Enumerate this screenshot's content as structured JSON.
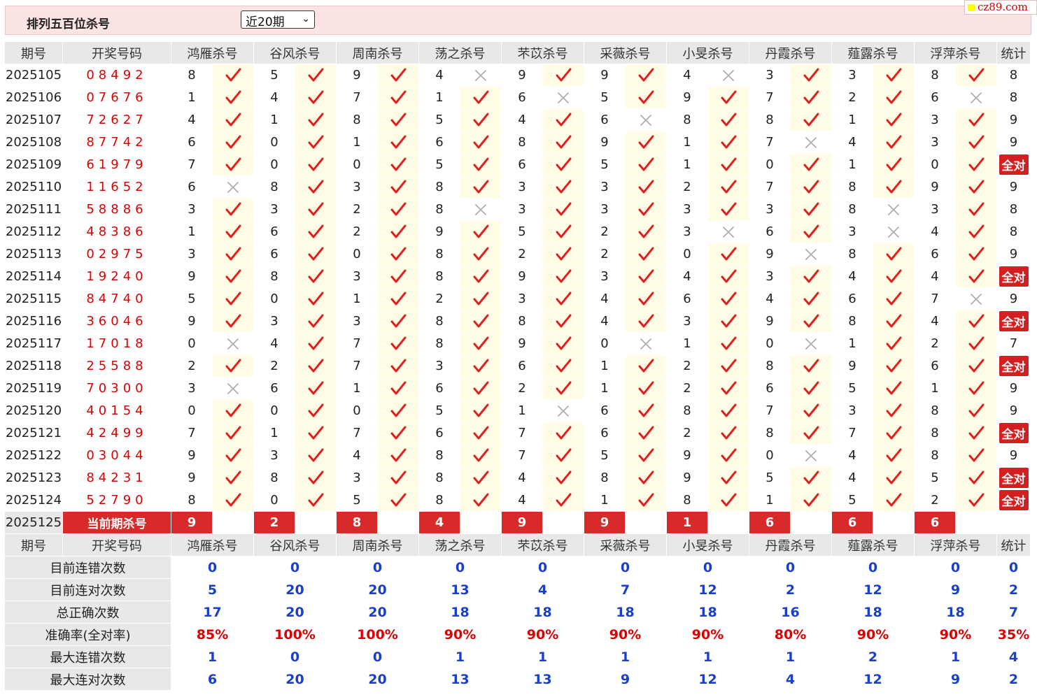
{
  "header": {
    "title": "排列五百位杀号",
    "period_select": "近20期",
    "logo": "cz89.com"
  },
  "columns": {
    "period": "期号",
    "draw": "开奖号码",
    "experts": [
      "鸿雁杀号",
      "谷风杀号",
      "周南杀号",
      "荡之杀号",
      "芣苡杀号",
      "采薇杀号",
      "小旻杀号",
      "丹霞杀号",
      "薤露杀号",
      "浮萍杀号"
    ],
    "stat": "统计"
  },
  "rows": [
    {
      "period": "2025105",
      "draw": "08492",
      "kills": [
        "8",
        "5",
        "9",
        "4",
        "9",
        "9",
        "4",
        "3",
        "3",
        "8"
      ],
      "marks": [
        1,
        1,
        1,
        0,
        1,
        1,
        0,
        1,
        1,
        1
      ],
      "stat": "8"
    },
    {
      "period": "2025106",
      "draw": "07676",
      "kills": [
        "1",
        "4",
        "7",
        "1",
        "6",
        "5",
        "9",
        "7",
        "2",
        "6"
      ],
      "marks": [
        1,
        1,
        1,
        1,
        0,
        1,
        1,
        1,
        1,
        0
      ],
      "stat": "8"
    },
    {
      "period": "2025107",
      "draw": "72627",
      "kills": [
        "4",
        "1",
        "8",
        "5",
        "4",
        "6",
        "8",
        "8",
        "1",
        "3"
      ],
      "marks": [
        1,
        1,
        1,
        1,
        1,
        0,
        1,
        1,
        1,
        1
      ],
      "stat": "9"
    },
    {
      "period": "2025108",
      "draw": "87742",
      "kills": [
        "6",
        "0",
        "1",
        "6",
        "8",
        "9",
        "1",
        "7",
        "4",
        "3"
      ],
      "marks": [
        1,
        1,
        1,
        1,
        1,
        1,
        1,
        0,
        1,
        1
      ],
      "stat": "9"
    },
    {
      "period": "2025109",
      "draw": "61979",
      "kills": [
        "7",
        "0",
        "0",
        "5",
        "6",
        "5",
        "1",
        "0",
        "1",
        "0"
      ],
      "marks": [
        1,
        1,
        1,
        1,
        1,
        1,
        1,
        1,
        1,
        1
      ],
      "stat": "全对"
    },
    {
      "period": "2025110",
      "draw": "11652",
      "kills": [
        "6",
        "8",
        "3",
        "8",
        "3",
        "3",
        "2",
        "7",
        "8",
        "9"
      ],
      "marks": [
        0,
        1,
        1,
        1,
        1,
        1,
        1,
        1,
        1,
        1
      ],
      "stat": "9"
    },
    {
      "period": "2025111",
      "draw": "58886",
      "kills": [
        "3",
        "3",
        "2",
        "8",
        "3",
        "3",
        "3",
        "3",
        "8",
        "3"
      ],
      "marks": [
        1,
        1,
        1,
        0,
        1,
        1,
        1,
        1,
        0,
        1
      ],
      "stat": "8"
    },
    {
      "period": "2025112",
      "draw": "48386",
      "kills": [
        "1",
        "6",
        "2",
        "9",
        "5",
        "2",
        "3",
        "6",
        "3",
        "4"
      ],
      "marks": [
        1,
        1,
        1,
        1,
        1,
        1,
        0,
        1,
        0,
        1
      ],
      "stat": "8"
    },
    {
      "period": "2025113",
      "draw": "02975",
      "kills": [
        "3",
        "6",
        "0",
        "8",
        "2",
        "2",
        "0",
        "9",
        "8",
        "6"
      ],
      "marks": [
        1,
        1,
        1,
        1,
        1,
        1,
        1,
        0,
        1,
        1
      ],
      "stat": "9"
    },
    {
      "period": "2025114",
      "draw": "19240",
      "kills": [
        "9",
        "8",
        "3",
        "8",
        "9",
        "3",
        "4",
        "3",
        "4",
        "4"
      ],
      "marks": [
        1,
        1,
        1,
        1,
        1,
        1,
        1,
        1,
        1,
        1
      ],
      "stat": "全对"
    },
    {
      "period": "2025115",
      "draw": "84740",
      "kills": [
        "5",
        "0",
        "1",
        "2",
        "3",
        "4",
        "6",
        "4",
        "6",
        "7"
      ],
      "marks": [
        1,
        1,
        1,
        1,
        1,
        1,
        1,
        1,
        1,
        0
      ],
      "stat": "9"
    },
    {
      "period": "2025116",
      "draw": "36046",
      "kills": [
        "9",
        "3",
        "3",
        "8",
        "8",
        "4",
        "3",
        "9",
        "8",
        "4"
      ],
      "marks": [
        1,
        1,
        1,
        1,
        1,
        1,
        1,
        1,
        1,
        1
      ],
      "stat": "全对"
    },
    {
      "period": "2025117",
      "draw": "17018",
      "kills": [
        "0",
        "4",
        "7",
        "8",
        "9",
        "0",
        "1",
        "0",
        "1",
        "2"
      ],
      "marks": [
        0,
        1,
        1,
        1,
        1,
        0,
        1,
        0,
        1,
        1
      ],
      "stat": "7"
    },
    {
      "period": "2025118",
      "draw": "25588",
      "kills": [
        "2",
        "2",
        "7",
        "3",
        "6",
        "1",
        "2",
        "8",
        "9",
        "6"
      ],
      "marks": [
        1,
        1,
        1,
        1,
        1,
        1,
        1,
        1,
        1,
        1
      ],
      "stat": "全对"
    },
    {
      "period": "2025119",
      "draw": "70300",
      "kills": [
        "3",
        "6",
        "1",
        "6",
        "2",
        "1",
        "2",
        "6",
        "5",
        "1"
      ],
      "marks": [
        0,
        1,
        1,
        1,
        1,
        1,
        1,
        1,
        1,
        1
      ],
      "stat": "9"
    },
    {
      "period": "2025120",
      "draw": "40154",
      "kills": [
        "0",
        "0",
        "0",
        "5",
        "1",
        "6",
        "8",
        "7",
        "3",
        "8"
      ],
      "marks": [
        1,
        1,
        1,
        1,
        0,
        1,
        1,
        1,
        1,
        1
      ],
      "stat": "9"
    },
    {
      "period": "2025121",
      "draw": "42499",
      "kills": [
        "7",
        "1",
        "7",
        "6",
        "7",
        "6",
        "2",
        "8",
        "7",
        "8"
      ],
      "marks": [
        1,
        1,
        1,
        1,
        1,
        1,
        1,
        1,
        1,
        1
      ],
      "stat": "全对"
    },
    {
      "period": "2025122",
      "draw": "03044",
      "kills": [
        "9",
        "3",
        "4",
        "8",
        "7",
        "5",
        "9",
        "0",
        "4",
        "8"
      ],
      "marks": [
        1,
        1,
        1,
        1,
        1,
        1,
        1,
        0,
        1,
        1
      ],
      "stat": "9"
    },
    {
      "period": "2025123",
      "draw": "84231",
      "kills": [
        "9",
        "8",
        "3",
        "8",
        "4",
        "8",
        "9",
        "5",
        "4",
        "5"
      ],
      "marks": [
        1,
        1,
        1,
        1,
        1,
        1,
        1,
        1,
        1,
        1
      ],
      "stat": "全对"
    },
    {
      "period": "2025124",
      "draw": "52790",
      "kills": [
        "8",
        "0",
        "5",
        "8",
        "4",
        "1",
        "8",
        "1",
        "5",
        "2"
      ],
      "marks": [
        1,
        1,
        1,
        1,
        1,
        1,
        1,
        1,
        1,
        1
      ],
      "stat": "全对"
    }
  ],
  "current": {
    "period": "2025125",
    "label": "当前期杀号",
    "kills": [
      "9",
      "2",
      "8",
      "4",
      "9",
      "9",
      "1",
      "6",
      "6",
      "6"
    ]
  },
  "summary": [
    {
      "label": "目前连错次数",
      "values": [
        "0",
        "0",
        "0",
        "0",
        "0",
        "0",
        "0",
        "0",
        "0",
        "0"
      ],
      "stat": "0",
      "pct": false
    },
    {
      "label": "目前连对次数",
      "values": [
        "5",
        "20",
        "20",
        "13",
        "4",
        "7",
        "12",
        "2",
        "12",
        "9"
      ],
      "stat": "2",
      "pct": false
    },
    {
      "label": "总正确次数",
      "values": [
        "17",
        "20",
        "20",
        "18",
        "18",
        "18",
        "18",
        "16",
        "18",
        "18"
      ],
      "stat": "7",
      "pct": false
    },
    {
      "label": "准确率(全对率)",
      "values": [
        "85%",
        "100%",
        "100%",
        "90%",
        "90%",
        "90%",
        "90%",
        "80%",
        "90%",
        "90%"
      ],
      "stat": "35%",
      "pct": true
    },
    {
      "label": "最大连错次数",
      "values": [
        "1",
        "0",
        "0",
        "1",
        "1",
        "1",
        "1",
        "1",
        "2",
        "1"
      ],
      "stat": "4",
      "pct": false
    },
    {
      "label": "最大连对次数",
      "values": [
        "6",
        "20",
        "20",
        "13",
        "13",
        "9",
        "12",
        "4",
        "12",
        "9"
      ],
      "stat": "2",
      "pct": false
    }
  ],
  "colors": {
    "hit": "#e02020",
    "miss": "#aaaaaa",
    "accent": "#d82a2a",
    "summary": "#1a3fc8"
  },
  "icons": {
    "hit": "check-icon",
    "miss": "cross-icon"
  }
}
